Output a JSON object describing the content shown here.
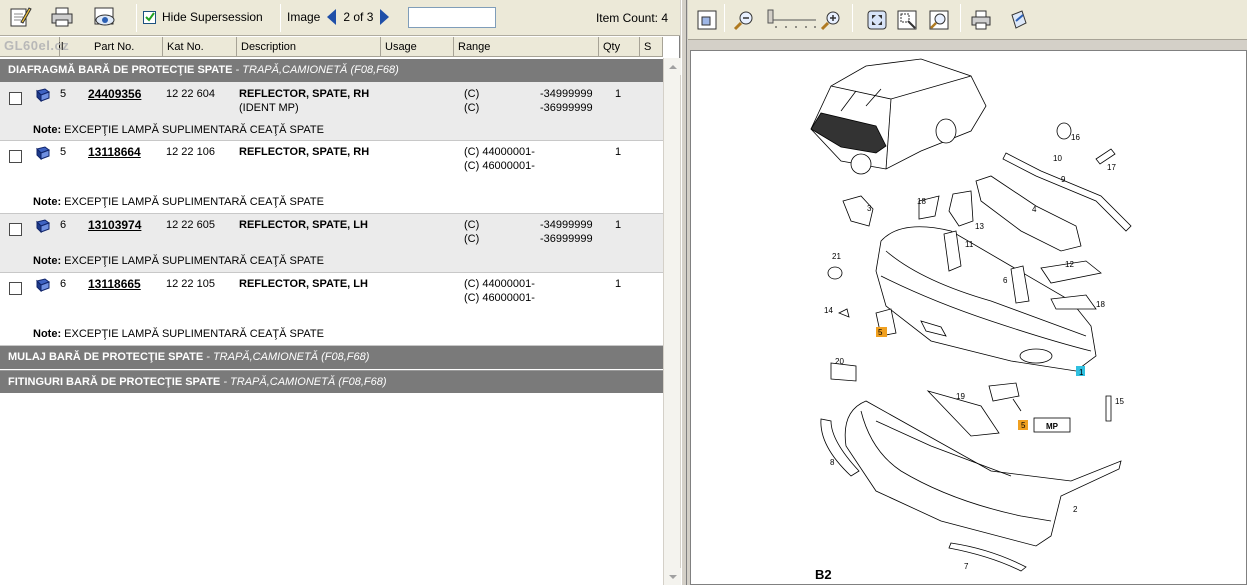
{
  "toolbar": {
    "hide_supersession_label": "Hide Supersession",
    "hide_supersession_checked": true,
    "image_label": "Image",
    "image_position": "2 of 3",
    "image_search_value": "",
    "item_count": "Item Count: 4"
  },
  "watermark": "GL60el.cz",
  "columns": [
    "Il",
    "Part No.",
    "Kat No.",
    "Description",
    "Usage",
    "Range",
    "Qty",
    "S"
  ],
  "groups": [
    {
      "title": "DIAFRAGMĂ BARĂ DE PROTECŢIE SPATE",
      "subtitle": " - TRAPĂ,CAMIONETĂ (F08,F68)"
    },
    {
      "title": "MULAJ BARĂ DE PROTECŢIE SPATE",
      "subtitle": " - TRAPĂ,CAMIONETĂ (F08,F68)"
    },
    {
      "title": "FITINGURI BARĂ DE PROTECŢIE SPATE",
      "subtitle": " - TRAPĂ,CAMIONETĂ (F08,F68)"
    }
  ],
  "parts": [
    {
      "il": "5",
      "part_no": "24409356",
      "kat_no": "12 22 604",
      "description": "REFLECTOR, SPATE, RH",
      "description_2": "(IDENT MP)",
      "range_1a": "(C)",
      "range_1b": "-34999999",
      "range_2a": "(C)",
      "range_2b": "-36999999",
      "qty": "1",
      "note_label": "Note:",
      "note_text": " EXCEPŢIE LAMPĂ SUPLIMENTARĂ CEAŢĂ SPATE"
    },
    {
      "il": "5",
      "part_no": "13118664",
      "kat_no": "12 22 106",
      "description": "REFLECTOR, SPATE, RH",
      "description_2": "",
      "range_1a": "(C) 44000001-",
      "range_1b": "",
      "range_2a": "(C) 46000001-",
      "range_2b": "",
      "qty": "1",
      "note_label": "Note:",
      "note_text": " EXCEPŢIE LAMPĂ SUPLIMENTARĂ CEAŢĂ SPATE"
    },
    {
      "il": "6",
      "part_no": "13103974",
      "kat_no": "12 22 605",
      "description": "REFLECTOR, SPATE, LH",
      "description_2": "",
      "range_1a": "(C)",
      "range_1b": "-34999999",
      "range_2a": "(C)",
      "range_2b": "-36999999",
      "qty": "1",
      "note_label": "Note:",
      "note_text": " EXCEPŢIE LAMPĂ SUPLIMENTARĂ CEAŢĂ SPATE"
    },
    {
      "il": "6",
      "part_no": "13118665",
      "kat_no": "12 22 105",
      "description": "REFLECTOR, SPATE, LH",
      "description_2": "",
      "range_1a": "(C) 44000001-",
      "range_1b": "",
      "range_2a": "(C) 46000001-",
      "range_2b": "",
      "qty": "1",
      "note_label": "Note:",
      "note_text": " EXCEPŢIE LAMPĂ SUPLIMENTARĂ CEAŢĂ SPATE"
    }
  ],
  "diagram": {
    "page_label": "B2",
    "mp_label": "MP",
    "callouts": [
      "1",
      "2",
      "3",
      "4",
      "5",
      "6",
      "7",
      "8",
      "9",
      "10",
      "11",
      "12",
      "13",
      "14",
      "15",
      "16",
      "17",
      "18",
      "19",
      "20",
      "21"
    ],
    "highlight_orange": "#f0a020",
    "highlight_cyan": "#30c0e0"
  },
  "colors": {
    "group_header_bg": "#7a7a7a",
    "toolbar_bg": "#ece9d8",
    "row_shade": "#ebebeb",
    "nav_arrow": "#1f4fa8"
  }
}
